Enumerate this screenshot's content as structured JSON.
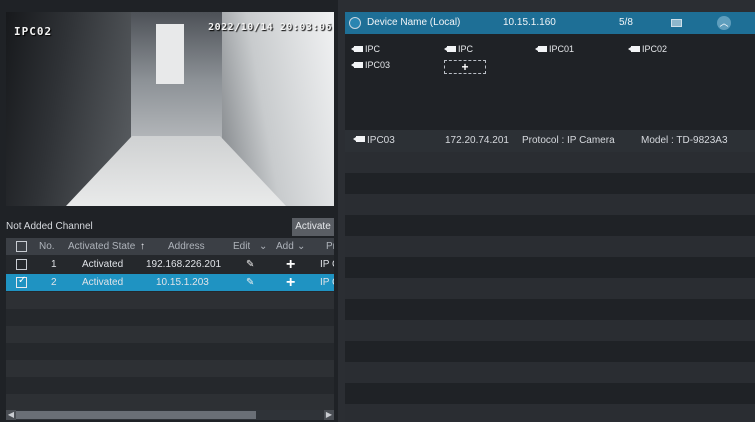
{
  "video": {
    "channel_name": "IPC02",
    "timestamp": "2022/10/14 20:03:06"
  },
  "not_added": {
    "title": "Not Added Channel",
    "activate_label": "Activate"
  },
  "grid": {
    "headers": {
      "no": "No.",
      "state": "Activated State",
      "sort_arrow": "↑",
      "address": "Address",
      "edit": "Edit",
      "add": "Add",
      "protocol": "Pr"
    },
    "rows": [
      {
        "no": "1",
        "state": "Activated",
        "address": "192.168.226.201",
        "protocol": "IP C",
        "checked": false
      },
      {
        "no": "2",
        "state": "Activated",
        "address": "10.15.1.203",
        "protocol": "IP C",
        "checked": true
      }
    ]
  },
  "device": {
    "name_label": "Device Name (Local)",
    "ip": "10.15.1.160",
    "count": "5/8",
    "channels": [
      "IPC",
      "IPC",
      "IPC01",
      "IPC02",
      "IPC03"
    ],
    "add_slot": "+"
  },
  "detail": {
    "name": "IPC03",
    "ip": "172.20.74.201",
    "protocol": "Protocol : IP Camera",
    "model": "Model : TD-9823A3"
  },
  "colors": {
    "accent": "#1f93c2",
    "header_blue": "#1e6f96",
    "panel_bg": "#1f2226"
  },
  "icons": {
    "monitor": "monitor-icon",
    "collapse": "chevron-up-icon",
    "camera": "camera-icon",
    "edit": "pencil-icon",
    "add": "plus-icon"
  }
}
